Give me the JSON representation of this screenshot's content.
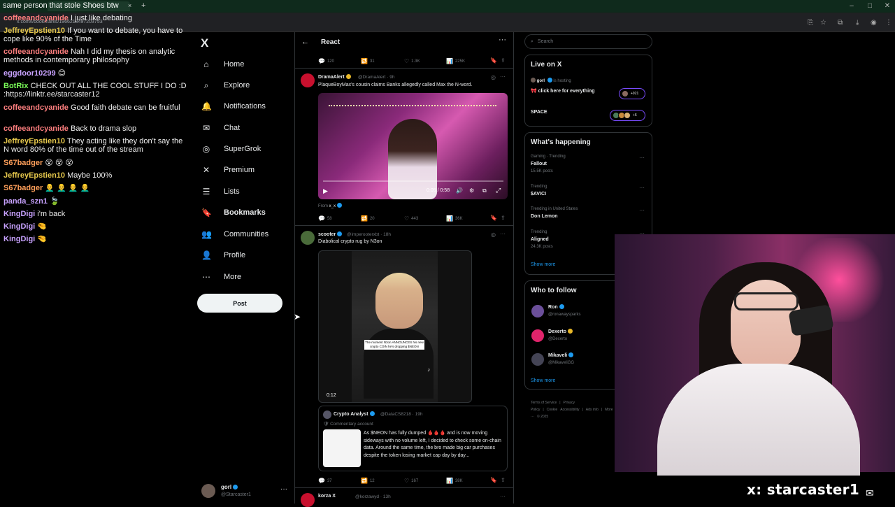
{
  "browser": {
    "tab_title": "same person that stole Shoes btw",
    "url": "x.com/i/bookmarks/1966218497203753",
    "new_tab": "+",
    "tab_close": "×"
  },
  "chat": [
    {
      "user": "coffeeandcyanide",
      "color": "#ff7f7f",
      "msg": "I just like debating"
    },
    {
      "user": "JeffreyEpstien10",
      "color": "#e6c84c",
      "msg": "If you want to debate, you have to cope like 90% of the Time"
    },
    {
      "user": "coffeeandcyanide",
      "color": "#ff7f7f",
      "msg": "Nah I did my thesis on analytic methods in contemporary philosophy"
    },
    {
      "user": "eggdoor10299",
      "color": "#c8a2ff",
      "msg": "😊"
    },
    {
      "user": "BotRix",
      "color": "#7cff5a",
      "msg": "CHECK OUT ALL THE COOL STUFF I DO :D :https://linktr.ee/starcaster12"
    },
    {
      "user": "coffeeandcyanide",
      "color": "#ff7f7f",
      "msg": "Good faith debate can be fruitful"
    },
    {
      "user": "coffeeandcyanide",
      "color": "#ff7f7f",
      "msg": "Back to drama slop"
    },
    {
      "user": "JeffreyEpstien10",
      "color": "#e6c84c",
      "msg": "They acting like they don't say the N word 80% of the time out of the stream"
    },
    {
      "user": "S67badger",
      "color": "#ff9f5a",
      "msg": "😵 😵 😵"
    },
    {
      "user": "JeffreyEpstien10",
      "color": "#e6c84c",
      "msg": "Maybe 100%"
    },
    {
      "user": "S67badger",
      "color": "#ff9f5a",
      "msg": "👨‍🦲 👨‍🦲 👨‍🦲 👨‍🦲"
    },
    {
      "user": "panda_szn1",
      "color": "#c8a2ff",
      "msg": "🍃"
    },
    {
      "user": "KingDigi",
      "color": "#c8a2ff",
      "msg": "i'm back"
    },
    {
      "user": "KingDigi",
      "color": "#c8a2ff",
      "msg": "🤏"
    },
    {
      "user": "KingDigi",
      "color": "#c8a2ff",
      "msg": "🤏"
    }
  ],
  "nav": {
    "logo": "X",
    "items": [
      {
        "label": "Home",
        "icon": "home-icon",
        "glyph": "⌂"
      },
      {
        "label": "Explore",
        "icon": "search-icon",
        "glyph": "⌕"
      },
      {
        "label": "Notifications",
        "icon": "bell-icon",
        "glyph": "🔔"
      },
      {
        "label": "Chat",
        "icon": "mail-icon",
        "glyph": "✉"
      },
      {
        "label": "SuperGrok",
        "icon": "grok-icon",
        "glyph": "◎"
      },
      {
        "label": "Premium",
        "icon": "x-premium-icon",
        "glyph": "✕"
      },
      {
        "label": "Lists",
        "icon": "lists-icon",
        "glyph": "☰"
      },
      {
        "label": "Bookmarks",
        "icon": "bookmark-icon",
        "glyph": "🔖"
      },
      {
        "label": "Communities",
        "icon": "communities-icon",
        "glyph": "👥"
      },
      {
        "label": "Profile",
        "icon": "person-icon",
        "glyph": "👤"
      },
      {
        "label": "More",
        "icon": "more-circle-icon",
        "glyph": "⋯"
      }
    ],
    "post": "Post",
    "profile": {
      "name": "gorl",
      "handle": "@Starcaster1",
      "more": "···"
    }
  },
  "timeline": {
    "title": "React",
    "back": "←",
    "more": "···",
    "top_actions": {
      "replies": "120",
      "reposts": "31",
      "likes": "1.3K",
      "views": "225K"
    },
    "tweets": [
      {
        "name": "DramaAlert",
        "handle": "@DramaAlert",
        "time": "· 9h",
        "text": "PlaqueBoyMax's cousin claims Banks allegedly called Max the N-word.",
        "video_time": "0:05 / 0:58",
        "from": "From",
        "from_handle": "x_x",
        "actions": {
          "replies": "58",
          "reposts": "20",
          "likes": "443",
          "views": "36K"
        }
      },
      {
        "name": "scooter",
        "handle": "@imperooterxbt",
        "time": "· 18h",
        "text": "Diabolical crypto rug by N3on",
        "video_time": "0:12",
        "caption": "The moment N3on ANNOUNCES his new crypto COIN he's dropping $NEON",
        "quote": {
          "name": "Crypto Analyst",
          "handle": "@DataCS8218",
          "time": "· 19h",
          "sub": "Commentary account",
          "text": "As $NEON has fully dumped 🩸🩸🩸 and is now moving sideways with no volume left, I decided to check some on-chain data. Around the same time, the bro made big car purchases despite the token losing market cap day by day..."
        },
        "actions": {
          "replies": "37",
          "reposts": "12",
          "likes": "167",
          "views": "38K"
        }
      },
      {
        "name": "korza X",
        "handle": "@korzawyd",
        "time": "· 13h"
      }
    ]
  },
  "right": {
    "search_placeholder": "Search",
    "live": {
      "title": "Live on X",
      "host": "gorl",
      "hosting": "is hosting",
      "stream_title": "🎀 click here for everything",
      "count": "+921",
      "space": "SPACE",
      "space_count": "+6"
    },
    "happening": {
      "title": "What's happening",
      "trends": [
        {
          "context": "Gaming · Trending",
          "name": "Fallout",
          "posts": "15.5K posts"
        },
        {
          "context": "Trending",
          "name": "$AVICI",
          "posts": ""
        },
        {
          "context": "Trending in United States",
          "name": "Don Lemon",
          "posts": ""
        },
        {
          "context": "Trending",
          "name": "Aligned",
          "posts": "24.3K posts"
        }
      ],
      "show_more": "Show more"
    },
    "follow": {
      "title": "Who to follow",
      "people": [
        {
          "name": "Ron",
          "handle": "@ronawaysparks",
          "color": "#6b4f9a"
        },
        {
          "name": "Dexerto",
          "handle": "@Dexerto",
          "color": "#e0246b"
        },
        {
          "name": "Mikaveli",
          "handle": "@MikaveliGG",
          "color": "#444455"
        }
      ],
      "show_more": "Show more"
    },
    "footer": [
      "Terms of Service",
      "|",
      "Privacy Policy",
      "|",
      "Cookie",
      "Accessibility",
      "|",
      "Ads info",
      "|",
      "More ···",
      "© 2025"
    ]
  },
  "overlay": {
    "handle": "x: starcaster1",
    "mail": "✉"
  },
  "colors": {
    "accent": "#1d9bf0",
    "border": "#2f3336",
    "muted": "#71767b"
  }
}
